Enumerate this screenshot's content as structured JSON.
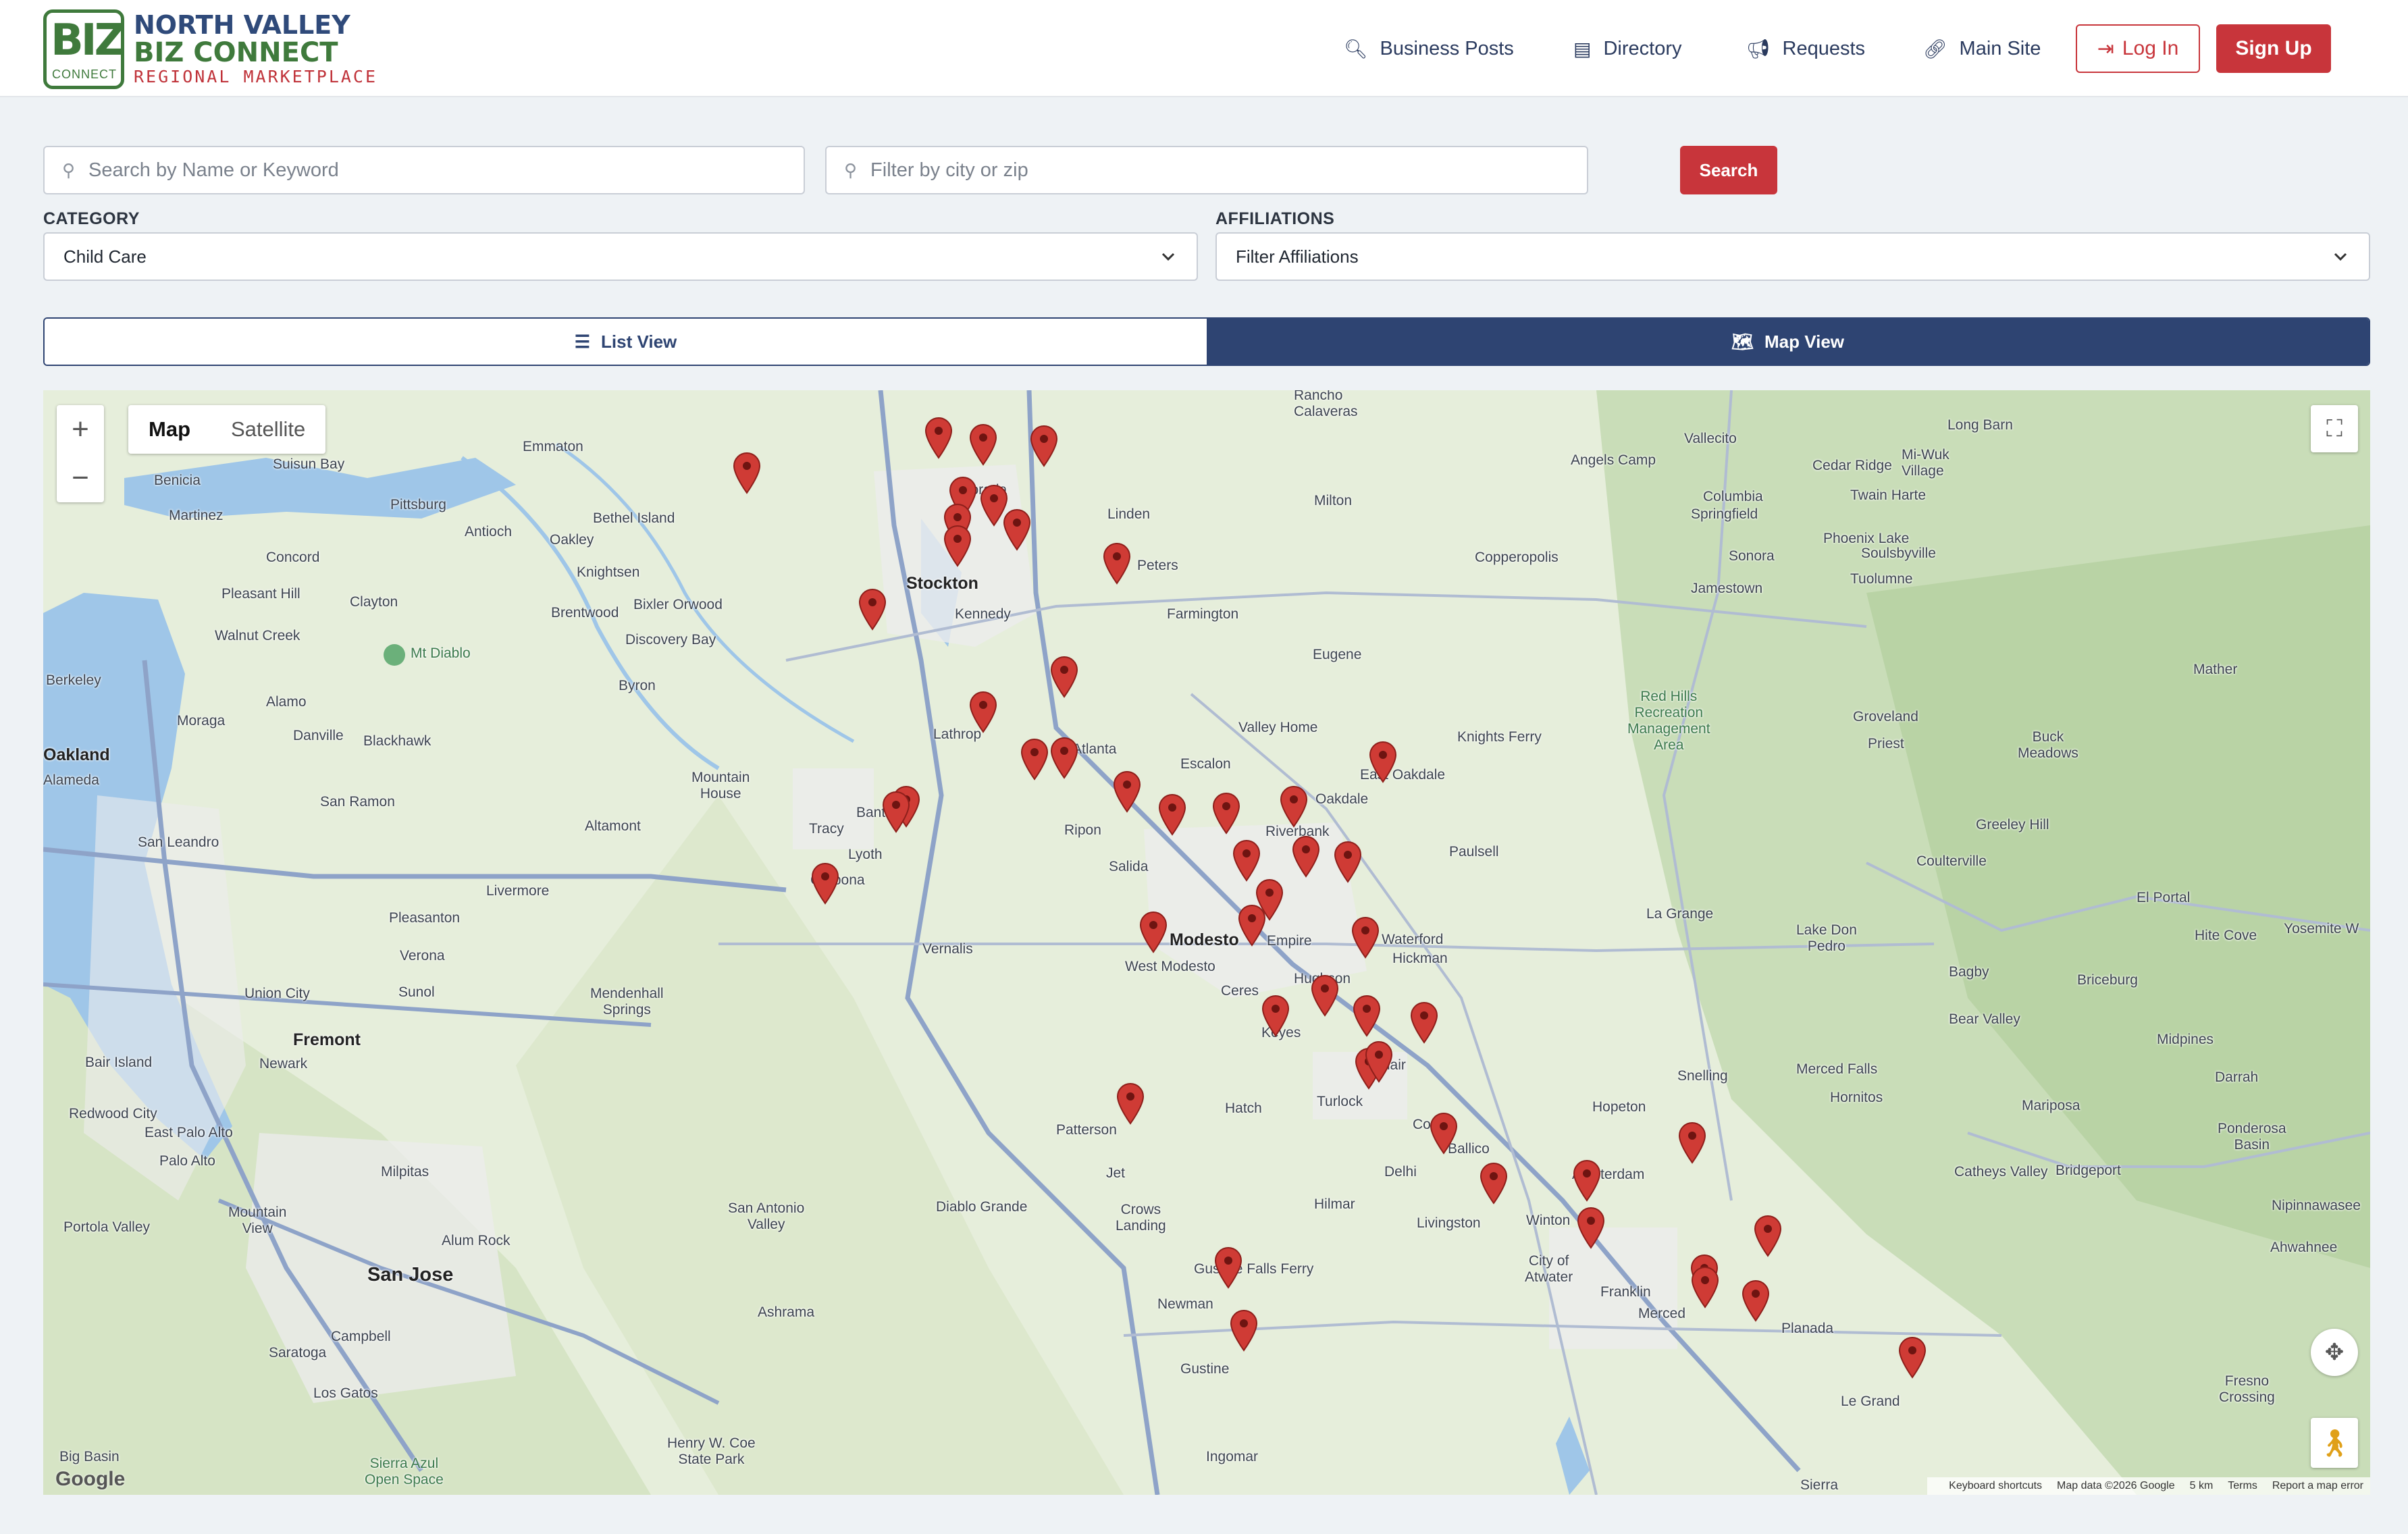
{
  "brand": {
    "badge_text": "BIZ",
    "badge_sub": "CONNECT",
    "line1": "NORTH VALLEY",
    "line2": "BIZ CONNECT",
    "line3": "REGIONAL MARKETPLACE",
    "colors": {
      "navy": "#2f4a7a",
      "green": "#3f7a3c",
      "red": "#c0333a"
    }
  },
  "nav": {
    "business_posts": "Business Posts",
    "directory": "Directory",
    "requests": "Requests",
    "main_site": "Main Site",
    "login": "Log In",
    "signup": "Sign Up",
    "icons": [
      "search-icon",
      "table-icon",
      "megaphone-icon",
      "link-icon",
      "sign-in-icon"
    ]
  },
  "search": {
    "keyword_placeholder": "Search by Name or Keyword",
    "city_placeholder": "Filter by city or zip",
    "button": "Search"
  },
  "filters": {
    "category_label": "CATEGORY",
    "category_value": "Child Care",
    "affiliations_label": "AFFILIATIONS",
    "affiliations_value": "Filter Affiliations"
  },
  "view_toggle": {
    "list": "List View",
    "map": "Map View",
    "active": "map",
    "accent": "#2e4472"
  },
  "map": {
    "type_map": "Map",
    "type_satellite": "Satellite",
    "active_type": "Map",
    "google": "Google",
    "attribution": {
      "shortcuts": "Keyboard shortcuts",
      "data": "Map data ©2026 Google",
      "scale": "5 km",
      "terms": "Terms",
      "report": "Report a map error"
    },
    "marker_color": "#cf3b35",
    "places": [
      "Rancho Calaveras",
      "Vallecito",
      "Long Barn",
      "Emmaton",
      "Suisun Bay",
      "Benicia",
      "Pittsburg",
      "Martinez",
      "Antioch",
      "Oakley",
      "Bethel Island",
      "Morada",
      "Linden",
      "Milton",
      "Angels Camp",
      "Cedar Ridge",
      "Mi-Wuk Village",
      "Twain Harte",
      "Columbia",
      "Springfield",
      "Phoenix Lake",
      "Soulsbyville",
      "Sonora",
      "Tuolumne",
      "Jamestown",
      "Concord",
      "Knightsen",
      "Bixler",
      "Orwood",
      "Stockton",
      "Peters",
      "Copperopolis",
      "Pleasant Hill",
      "Clayton",
      "Brentwood",
      "Discovery Bay",
      "Farmington",
      "Walnut Creek",
      "Mt Diablo",
      "Kennedy",
      "Eugene",
      "Berkeley",
      "Moraga",
      "Alamo",
      "Byron",
      "Valley Home",
      "Knights Ferry",
      "Red Hills Recreation Management Area",
      "Groveland",
      "Mather",
      "Oakland",
      "Alameda",
      "Danville",
      "Blackhawk",
      "Lathrop",
      "Atlanta",
      "Escalon",
      "East Oakdale",
      "Priest",
      "Buck Meadows",
      "Oakdale",
      "San Ramon",
      "Mountain House",
      "Banta",
      "Altamont",
      "Tracy",
      "Ripon",
      "Riverbank",
      "Greeley Hill",
      "San Leandro",
      "Lyoth",
      "Salida",
      "Paulsell",
      "Coulterville",
      "Livermore",
      "Carbona",
      "Modesto",
      "Empire",
      "Waterford",
      "Hickman",
      "La Grange",
      "El Portal",
      "Pleasanton",
      "Vernalis",
      "West Modesto",
      "Hughson",
      "Lake Don Pedro",
      "Hite Cove",
      "Yosemite W",
      "Verona",
      "Sunol",
      "Ceres",
      "Bagby",
      "Briceburg",
      "Union City",
      "Mendenhall Springs",
      "Keyes",
      "Bear Valley",
      "Fremont",
      "Denair",
      "Midpines",
      "Newark",
      "Bair Island",
      "Snelling",
      "Merced Falls",
      "Darrah",
      "Redwood City",
      "Turlock",
      "Hatch",
      "Hopeton",
      "Hornitos",
      "Mariposa",
      "East Palo Alto",
      "Patterson",
      "Cortez",
      "Ponderosa Basin",
      "Palo Alto",
      "Milpitas",
      "Delhi",
      "Ballico",
      "Amsterdam",
      "Catheys Valley",
      "Bridgeport",
      "Jet",
      "Crows Landing",
      "Diablo Grande",
      "Hilmar",
      "Livingston",
      "Winton",
      "Nipinnawasee",
      "Portola Valley",
      "Mountain View",
      "Alum Rock",
      "San Antonio Valley",
      "Atwater",
      "Ahwahnee",
      "San Jose",
      "Gustine Falls Ferry",
      "Newman",
      "Franklin",
      "Merced",
      "Ashrama",
      "Planada",
      "Campbell",
      "Saratoga",
      "Gustine",
      "Le Grand",
      "Fresno Crossing",
      "Los Gatos",
      "Henry W. Coe State Park",
      "Ingomar",
      "Big Basin",
      "Sierra Azul Open Space",
      "Sierra"
    ]
  }
}
